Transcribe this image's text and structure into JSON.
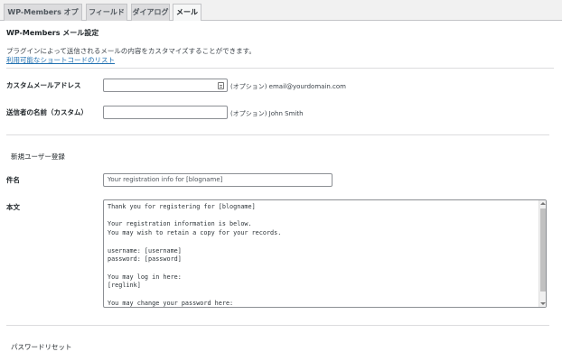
{
  "tabs": [
    {
      "label": "WP-Members オプション",
      "active": false
    },
    {
      "label": "フィールド",
      "active": false
    },
    {
      "label": "ダイアログ",
      "active": false
    },
    {
      "label": "メール",
      "active": true
    }
  ],
  "settings": {
    "title": "WP-Members メール設定",
    "description": "プラグインによって送信されるメールの内容をカスタマイズすることができます。",
    "shortcode_link": "利用可能なショートコードのリスト"
  },
  "custom_email": {
    "label": "カスタムメールアドレス",
    "value": "",
    "hint": "(オプション) email@yourdomain.com",
    "icon": "contact-card-icon"
  },
  "sender_name": {
    "label": "送信者の名前（カスタム）",
    "value": "",
    "hint": "(オプション) John Smith"
  },
  "new_registration": {
    "section_title": "新規ユーザー登録",
    "subject_label": "件名",
    "subject_value": "Your registration info for [blogname]",
    "body_label": "本文",
    "body_value": "Thank you for registering for [blogname]\n\nYour registration information is below.\nYou may wish to retain a copy for your records.\n\nusername: [username]\npassword: [password]\n\nYou may log in here:\n[reglink]\n\nYou may change your password here:"
  },
  "password_reset": {
    "section_title": "パスワードリセット"
  }
}
